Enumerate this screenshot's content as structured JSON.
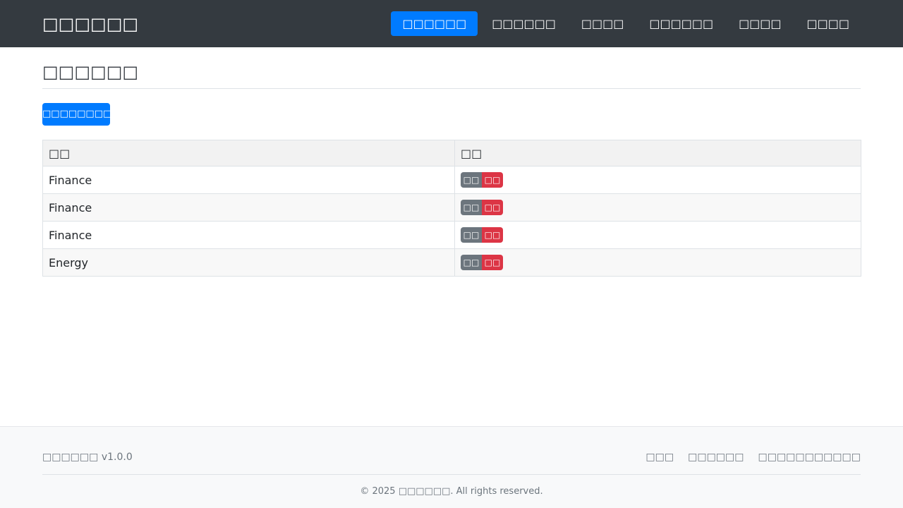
{
  "header": {
    "brand": "□□□□□□",
    "nav": [
      {
        "label": "□□□□□□",
        "active": true
      },
      {
        "label": "□□□□□□",
        "active": false
      },
      {
        "label": "□□□□",
        "active": false
      },
      {
        "label": "□□□□□□",
        "active": false
      },
      {
        "label": "□□□□",
        "active": false
      },
      {
        "label": "□□□□",
        "active": false
      }
    ],
    "accent_color": "#007bff"
  },
  "main": {
    "title": "□□□□□□",
    "add_button": "□□□□□□□□",
    "table": {
      "columns": [
        "□□",
        "□□"
      ],
      "rows": [
        {
          "name": "Finance",
          "edit": "□□",
          "delete": "□□"
        },
        {
          "name": "Finance",
          "edit": "□□",
          "delete": "□□"
        },
        {
          "name": "Finance",
          "edit": "□□",
          "delete": "□□"
        },
        {
          "name": "Energy",
          "edit": "□□",
          "delete": "□□"
        }
      ]
    }
  },
  "footer": {
    "version": "□□□□□□ v1.0.0",
    "links": [
      "□□□",
      "□□□□□□",
      "□□□□□□□□□□□"
    ],
    "copyright": "© 2025 □□□□□□. All rights reserved."
  }
}
